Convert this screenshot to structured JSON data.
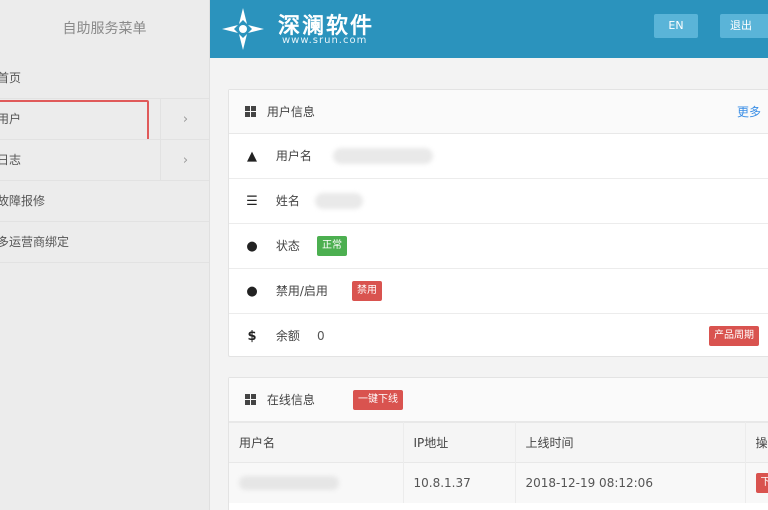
{
  "sidebar": {
    "title": "自助服务菜单",
    "items": [
      {
        "label": "首页",
        "has_arrow": false
      },
      {
        "label": "用户",
        "has_arrow": true,
        "arrow": "›"
      },
      {
        "label": "日志",
        "has_arrow": true,
        "arrow": "›"
      },
      {
        "label": "故障报修",
        "has_arrow": false
      },
      {
        "label": "多运营商绑定",
        "has_arrow": false
      }
    ]
  },
  "header": {
    "brand_name": "深澜软件",
    "brand_url": "www.srun.com",
    "lang_button": "EN",
    "logout_button": "退出"
  },
  "user_panel": {
    "title": "用户信息",
    "more_link": "更多",
    "rows": {
      "username_label": "用户名",
      "name_label": "姓名",
      "status_label": "状态",
      "status_value": "正常",
      "toggle_label": "禁用/启用",
      "toggle_value": "禁用",
      "balance_label": "余额",
      "balance_value": "0",
      "product_button": "产品周期"
    }
  },
  "online_panel": {
    "title": "在线信息",
    "offline_button": "一键下线",
    "columns": [
      "用户名",
      "IP地址",
      "上线时间",
      "操"
    ],
    "rows": [
      {
        "username": "",
        "ip": "10.8.1.37",
        "online_time": "2018-12-19 08:12:06",
        "action": "下"
      }
    ]
  },
  "colors": {
    "header_bg": "#2b93bd",
    "highlight_border": "#e05a5a",
    "status_green": "#4caf50",
    "danger_red": "#d9534f",
    "link_blue": "#3a8ee6"
  }
}
